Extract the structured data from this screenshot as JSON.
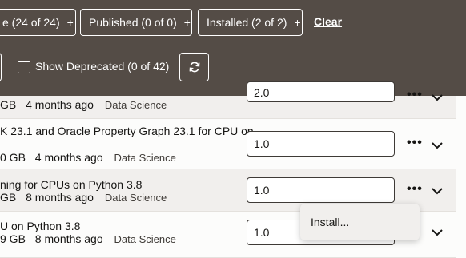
{
  "filters": {
    "chip1_label": "e (24 of 24)",
    "chip1_plus": "+",
    "chip2_label": "Published (0 of 0)",
    "chip2_plus": "+",
    "chip3_label": "Installed (2 of 2)",
    "chip3_plus": "+",
    "clear_label": "Clear",
    "show_deprecated_label": "Show Deprecated (0 of 42)"
  },
  "rows": [
    {
      "title": "",
      "size": "GB",
      "age": "4 months ago",
      "category": "Data Science",
      "version": "2.0"
    },
    {
      "title": "K 23.1 and Oracle Property Graph 23.1 for CPU on",
      "size": "0 GB",
      "age": "4 months ago",
      "category": "Data Science",
      "version": "1.0"
    },
    {
      "title": "ning for CPUs on Python 3.8",
      "size": "GB",
      "age": "8 months ago",
      "category": "Data Science",
      "version": "1.0"
    },
    {
      "title": "U on Python 3.8",
      "size": "9 GB",
      "age": "8 months ago",
      "category": "Data Science",
      "version": "1.0"
    }
  ],
  "context_menu": {
    "install_label": "Install..."
  },
  "colors": {
    "filterbar_bg": "#544c46",
    "row_shaded_bg": "#f1efed"
  },
  "icons": {
    "refresh": "refresh-icon",
    "more": "more-actions-icon",
    "chevron": "chevron-down-icon"
  }
}
